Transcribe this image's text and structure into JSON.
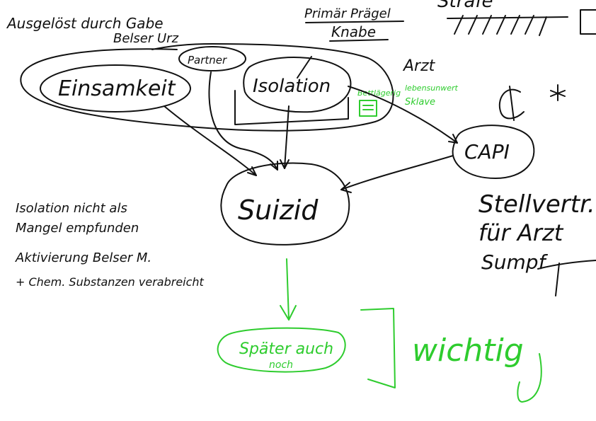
{
  "header": {
    "triggered_line1": "Ausgelöst durch Gabe",
    "triggered_line2": "Belser Urz",
    "primary_line1": "Primär Prägel",
    "primary_line2": "Knabe",
    "top_right_partial": "Strafe",
    "doctor": "Arzt"
  },
  "nodes": {
    "loneliness": "Einsamkeit",
    "partner": "Partner",
    "isolation": "Isolation",
    "suicide": "Suizid",
    "capi": "CAPI",
    "later": "Später auch",
    "later_sub": "noch"
  },
  "green_note": {
    "line1": "Bettlägerig",
    "line2": "lebensunwert",
    "line3": "Sklave"
  },
  "notes": {
    "left_line1": "Isolation nicht als",
    "left_line2": "Mangel empfunden",
    "left_line3": "Aktivierung Belser M.",
    "left_line4": "+ Chem. Substanzen verabreicht",
    "right_line1": "Stellvertr.",
    "right_line2": "für Arzt",
    "right_line3": "Sumpf",
    "important": "wichtig"
  },
  "colors": {
    "ink": "#111111",
    "green": "#2ecc2e",
    "background": "#ffffff"
  }
}
